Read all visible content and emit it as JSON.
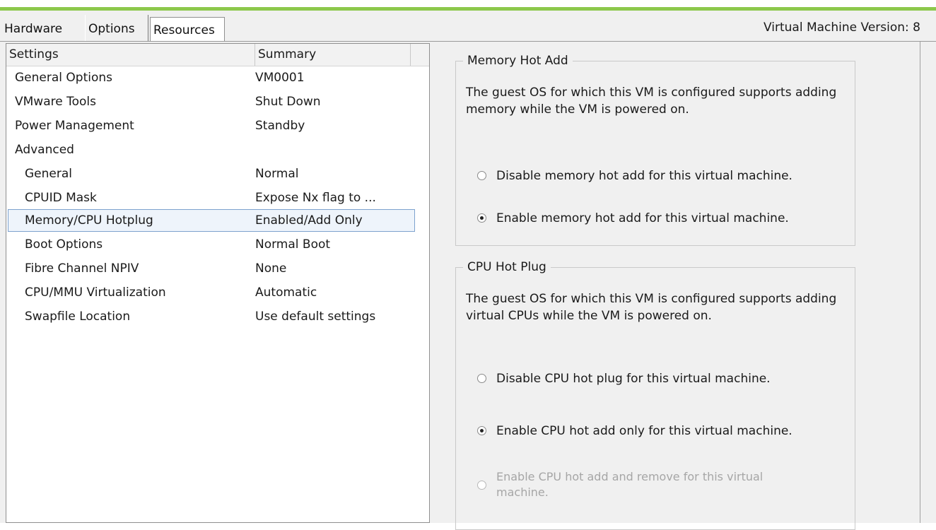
{
  "tabs": [
    {
      "label": "Hardware"
    },
    {
      "label": "Options"
    },
    {
      "label": "Resources"
    }
  ],
  "header": {
    "version": "Virtual Machine Version: 8"
  },
  "list": {
    "columns": {
      "settings": "Settings",
      "summary": "Summary"
    },
    "rows": [
      {
        "name": "General Options",
        "summary": "VM0001"
      },
      {
        "name": "VMware Tools",
        "summary": "Shut Down"
      },
      {
        "name": "Power Management",
        "summary": "Standby"
      },
      {
        "name": "Advanced",
        "summary": ""
      },
      {
        "name": "General",
        "summary": "Normal"
      },
      {
        "name": "CPUID Mask",
        "summary": "Expose Nx flag to ..."
      },
      {
        "name": "Memory/CPU Hotplug",
        "summary": "Enabled/Add Only"
      },
      {
        "name": "Boot Options",
        "summary": "Normal Boot"
      },
      {
        "name": "Fibre Channel NPIV",
        "summary": "None"
      },
      {
        "name": "CPU/MMU Virtualization",
        "summary": "Automatic"
      },
      {
        "name": "Swapfile Location",
        "summary": "Use default settings"
      }
    ],
    "selected_index": 6
  },
  "memory_hot_add": {
    "legend": "Memory Hot Add",
    "description": "The guest OS for which this VM is configured supports adding memory while the VM is powered on.",
    "options": [
      {
        "label": "Disable memory hot add for this virtual machine.",
        "checked": false,
        "disabled": false
      },
      {
        "label": "Enable memory hot add for this virtual machine.",
        "checked": true,
        "disabled": false
      }
    ]
  },
  "cpu_hot_plug": {
    "legend": "CPU Hot Plug",
    "description": "The guest OS for which this VM is configured supports adding virtual CPUs while the VM is powered on.",
    "options": [
      {
        "label": "Disable CPU hot plug for this virtual machine.",
        "checked": false,
        "disabled": false
      },
      {
        "label": "Enable CPU hot add only for this virtual machine.",
        "checked": true,
        "disabled": false
      },
      {
        "label": "Enable CPU hot add and remove for this virtual machine.",
        "checked": false,
        "disabled": true
      }
    ]
  },
  "colors": {
    "accent_bar": "#8cc84b",
    "selection_border": "#7da2ce"
  }
}
